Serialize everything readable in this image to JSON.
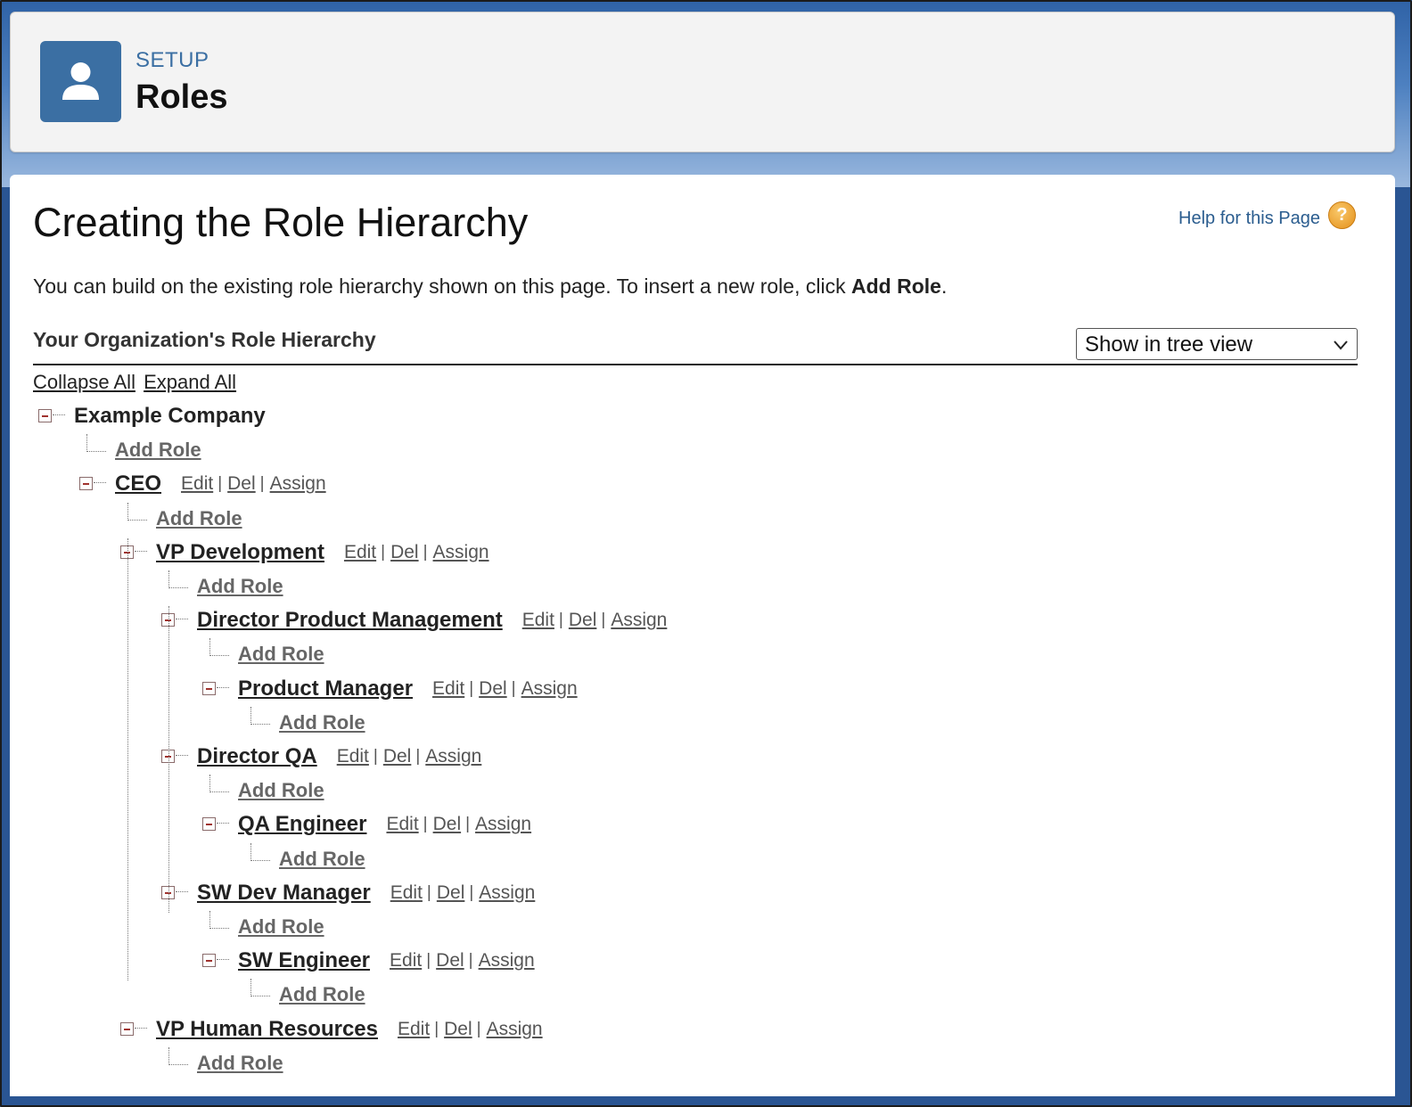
{
  "header": {
    "eyebrow": "SETUP",
    "title": "Roles",
    "icon": "user-icon",
    "icon_bg": "#3b6fa3"
  },
  "page": {
    "title": "Creating the Role Hierarchy",
    "help_label": "Help for this Page",
    "help_glyph": "?",
    "intro_prefix": "You can build on the existing role hierarchy shown on this page. To insert a new role, click ",
    "intro_bold": "Add Role",
    "intro_suffix": "."
  },
  "hierarchy": {
    "section_title": "Your Organization's Role Hierarchy",
    "view_select": "Show in tree view",
    "collapse_all": "Collapse All",
    "expand_all": "Expand All",
    "root": "Example Company",
    "add_role_label": "Add Role",
    "action_labels": {
      "edit": "Edit",
      "del": "Del",
      "assign": "Assign",
      "separator": "|"
    },
    "roles": [
      {
        "name": "CEO",
        "level": 1
      },
      {
        "name": "VP Development",
        "level": 2
      },
      {
        "name": "Director Product Management",
        "level": 3
      },
      {
        "name": "Product Manager",
        "level": 4
      },
      {
        "name": "Director QA",
        "level": 3
      },
      {
        "name": "QA Engineer",
        "level": 4
      },
      {
        "name": "SW Dev Manager",
        "level": 3
      },
      {
        "name": "SW Engineer",
        "level": 4
      },
      {
        "name": "VP Human Resources",
        "level": 2
      }
    ]
  },
  "colors": {
    "link": "#2b5d8f",
    "help_icon": "#e4901a",
    "collapse_minus": "#a0322e"
  }
}
